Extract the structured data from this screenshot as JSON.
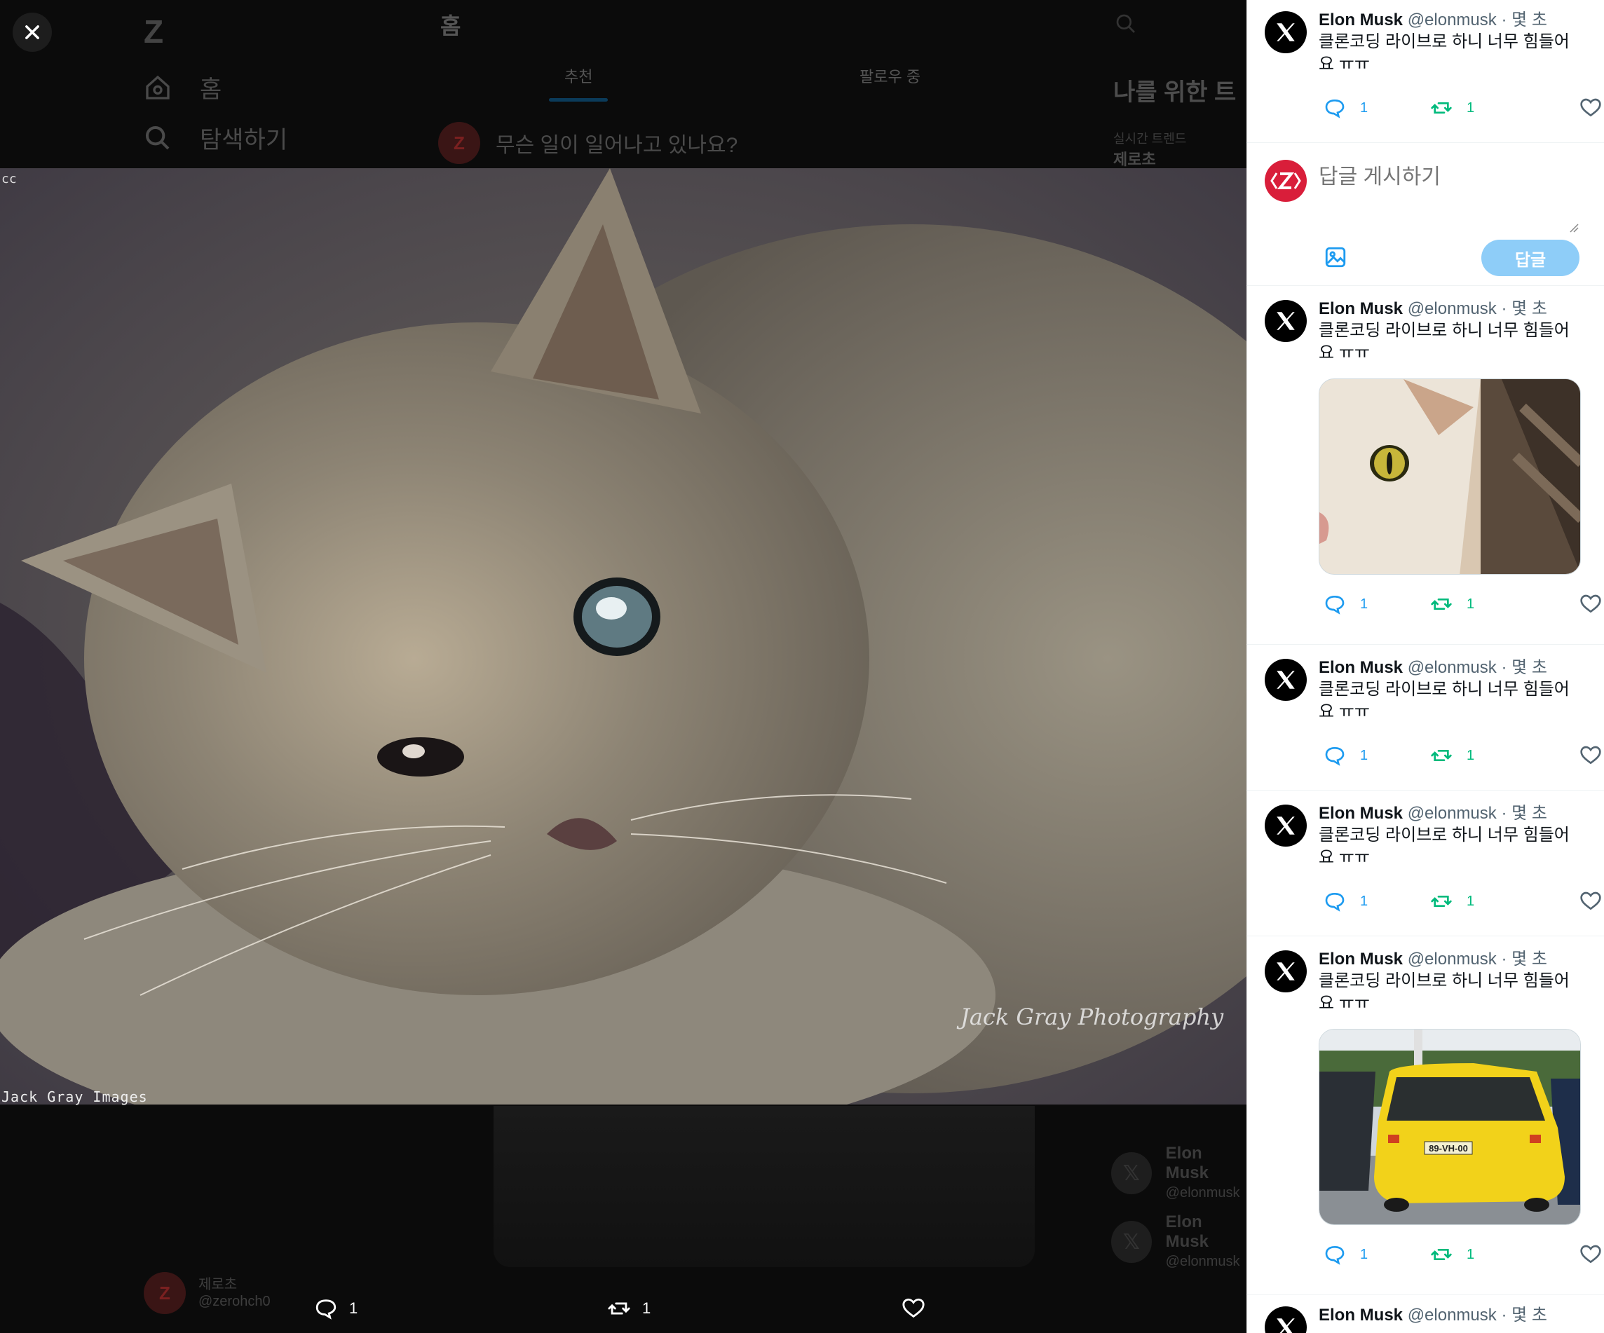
{
  "app": {
    "logo_text": "Z",
    "nav": [
      {
        "label": "홈",
        "icon": "home-icon"
      },
      {
        "label": "탐색하기",
        "icon": "search-icon"
      }
    ],
    "header_title": "홈",
    "tabs": [
      "추천",
      "팔로우 중"
    ],
    "compose_placeholder": "무슨 일이 일어나고 있나요?",
    "trends_title": "나를 위한 트",
    "trend_sub": "실시간 트렌드",
    "trend_name": "제로초",
    "current_user": {
      "name": "제로초",
      "handle": "@zerohch0"
    },
    "follow_suggestions": [
      {
        "name": "Elon Musk",
        "handle": "@elonmusk"
      },
      {
        "name": "Elon Musk",
        "handle": "@elonmusk"
      }
    ],
    "z_logo_letter": "Z"
  },
  "viewer": {
    "close_icon": "close-icon",
    "image_alt": "Kitten photo",
    "cc_tag": "cc",
    "credit_left": "Jack Gray Images",
    "credit_right": "Jack Gray Photography",
    "actions": {
      "reply_count": "1",
      "retweet_count": "1"
    }
  },
  "reply_composer": {
    "placeholder": "답글 게시하기",
    "submit_label": "답글"
  },
  "tweets": [
    {
      "name": "Elon Musk",
      "handle": "@elonmusk",
      "dot": "·",
      "time": "몇 초",
      "text": "클론코딩 라이브로 하니 너무 힘들어요 ㅠㅠ",
      "reply_count": "1",
      "retweet_count": "1",
      "media": null
    },
    {
      "name": "Elon Musk",
      "handle": "@elonmusk",
      "dot": "·",
      "time": "몇 초",
      "text": "클론코딩 라이브로 하니 너무 힘들어요 ㅠㅠ",
      "reply_count": "1",
      "retweet_count": "1",
      "media": "cat-photo"
    },
    {
      "name": "Elon Musk",
      "handle": "@elonmusk",
      "dot": "·",
      "time": "몇 초",
      "text": "클론코딩 라이브로 하니 너무 힘들어요 ㅠㅠ",
      "reply_count": "1",
      "retweet_count": "1",
      "media": null
    },
    {
      "name": "Elon Musk",
      "handle": "@elonmusk",
      "dot": "·",
      "time": "몇 초",
      "text": "클론코딩 라이브로 하니 너무 힘들어요 ㅠㅠ",
      "reply_count": "1",
      "retweet_count": "1",
      "media": null
    },
    {
      "name": "Elon Musk",
      "handle": "@elonmusk",
      "dot": "·",
      "time": "몇 초",
      "text": "클론코딩 라이브로 하니 너무 힘들어요 ㅠㅠ",
      "reply_count": "1",
      "retweet_count": "1",
      "media": "yellow-car-photo",
      "plate": "89-VH-00"
    },
    {
      "name": "Elon Musk",
      "handle": "@elonmusk",
      "dot": "·",
      "time": "몇 초"
    }
  ],
  "colors": {
    "reply_blue": "#1d9bf0",
    "retweet_green": "#00ba7c",
    "brand_red": "#d91e3a",
    "button_disabled": "#8ecdf8"
  }
}
